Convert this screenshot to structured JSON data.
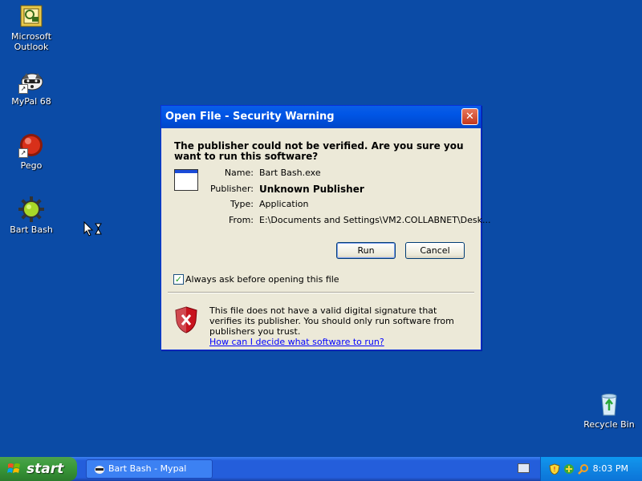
{
  "desktop": {
    "icons": [
      {
        "label_line1": "Microsoft",
        "label_line2": "Outlook"
      },
      {
        "label_line1": "MyPal 68",
        "label_line2": ""
      },
      {
        "label_line1": "Pego",
        "label_line2": ""
      },
      {
        "label_line1": "Bart Bash",
        "label_line2": ""
      },
      {
        "label_line1": "Recycle Bin",
        "label_line2": ""
      }
    ]
  },
  "dialog": {
    "title": "Open File - Security Warning",
    "question": "The publisher could not be verified.  Are you sure you want to run this software?",
    "fields": {
      "name_label": "Name:",
      "name_value": "Bart Bash.exe",
      "publisher_label": "Publisher:",
      "publisher_value": "Unknown Publisher",
      "type_label": "Type:",
      "type_value": "Application",
      "from_label": "From:",
      "from_value": "E:\\Documents and Settings\\VM2.COLLABNET\\Desk..."
    },
    "run_label": "Run",
    "cancel_label": "Cancel",
    "checkbox_label": "Always ask before opening this file",
    "checkbox_checked": true,
    "warning_text": "This file does not have a valid digital signature that verifies its publisher.  You should only run software from publishers you trust.",
    "help_link": "How can I decide what software to run?"
  },
  "taskbar": {
    "start_label": "start",
    "task_label": "Bart Bash - Mypal",
    "clock": "8:03 PM"
  },
  "colors": {
    "desktop": "#0b4ba6",
    "titlebar": "#0055e5",
    "dialog_bg": "#ece9d8",
    "start_green": "#3a9a3a",
    "link": "#0000ff"
  }
}
